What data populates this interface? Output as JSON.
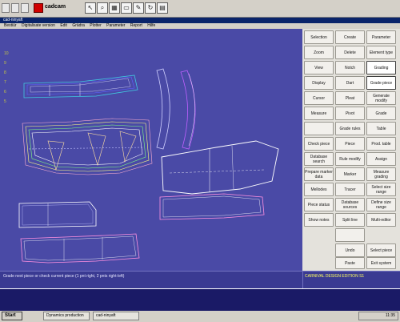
{
  "app": {
    "name": "cadcam",
    "window_title": "cad-ninyaft"
  },
  "menu": [
    "Bestiür",
    "Digitalisate version",
    "Edit",
    "Grädra",
    "Plotter",
    "Parameter",
    "Report",
    "Hilfe"
  ],
  "ruler_labels": [
    "10",
    "9",
    "8",
    "7",
    "6",
    "5"
  ],
  "panel": {
    "col1": [
      "Selection",
      "Zoom",
      "View",
      "Display",
      "Cursor",
      "Measure",
      "",
      "Check piece",
      "Database search",
      "Prepare marker data",
      "Mellodes",
      "Piece status",
      "Show notes"
    ],
    "col2": [
      "Create",
      "Delete",
      "Notch",
      "Dart",
      "Pleat",
      "Pivot",
      "Grade rules",
      "Piece",
      "Rule modify",
      "Marker",
      "Tracer",
      "Database sources",
      "Split line",
      "",
      "Undo",
      "Paste"
    ],
    "col3": [
      "Parameter",
      "Element type",
      "Grading",
      "Grade piece",
      "Generate modify",
      "Grade",
      "Table",
      "Prod. table",
      "Assign",
      "Measure grading",
      "Select size range",
      "Define size range",
      "Multi-editor",
      "",
      "",
      "Select piece",
      "Exit system"
    ],
    "active": [
      "Grading",
      "Grade piece"
    ]
  },
  "status": {
    "message": "Grade next piece or check current piece (1 pnt right, 2 pnts right-left)",
    "right_text": "CARNIVAL DESIGN EDITION S1"
  },
  "taskbar": {
    "start_label": "Start",
    "tasks": [
      "Dynamics production",
      "cad-ninyaft"
    ],
    "clock": "11:35"
  }
}
